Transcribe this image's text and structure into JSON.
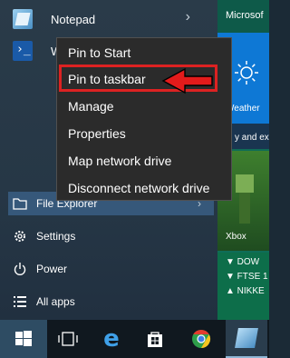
{
  "apps": [
    {
      "label": "Notepad"
    },
    {
      "label": "W"
    }
  ],
  "nav": {
    "file_explorer": "File Explorer",
    "settings": "Settings",
    "power": "Power",
    "all_apps": "All apps"
  },
  "context_menu": {
    "items": [
      "Pin to Start",
      "Pin to taskbar",
      "Manage",
      "Properties",
      "Map network drive",
      "Disconnect network drive"
    ],
    "highlighted_index": 1
  },
  "tiles": {
    "microsoft": "Microsof",
    "weather": "Weather",
    "news": "y and ex",
    "xbox": "Xbox",
    "money": [
      "▼ DOW",
      "▼ FTSE 1",
      "▲ NIKKE"
    ]
  },
  "taskbar": {
    "icons": [
      "windows-start-icon",
      "task-view-icon",
      "edge-icon",
      "store-icon",
      "chrome-icon",
      "notepad-icon"
    ]
  },
  "colors": {
    "highlight": "#dd2222",
    "tile_green": "#0f6c57",
    "tile_blue": "#0e78d5",
    "menu_bg": "#2b2b2b"
  }
}
